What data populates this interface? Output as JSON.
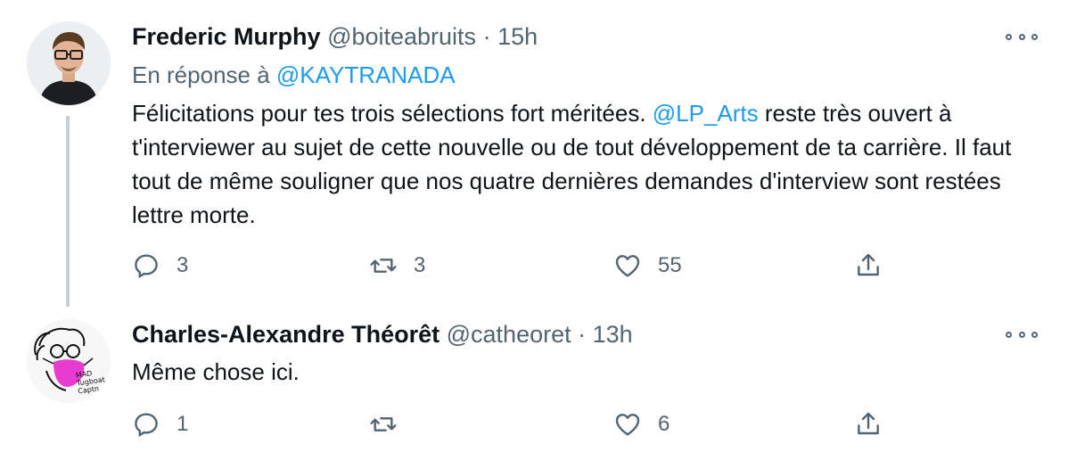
{
  "tweets": [
    {
      "name": "Frederic Murphy",
      "handle": "@boiteabruits",
      "separator": "·",
      "time": "15h",
      "reply_prefix": "En réponse à",
      "reply_to": "@KAYTRANADA",
      "text_part1": "Félicitations pour tes trois sélections fort méritées. ",
      "mention": "@LP_Arts",
      "text_part2": " reste très ouvert à t'interviewer au sujet de cette nouvelle ou de tout développement de ta carrière. Il faut tout de même souligner que nos quatre dernières demandes d'interview sont restées lettre morte.",
      "replies": "3",
      "retweets": "3",
      "likes": "55"
    },
    {
      "name": "Charles-Alexandre Théorêt",
      "handle": "@catheoret",
      "separator": "·",
      "time": "13h",
      "text": "Même chose ici.",
      "replies": "1",
      "retweets": "",
      "likes": "6",
      "avatar_caption": "MAD Tugboat Captn"
    }
  ],
  "colors": {
    "link": "#1d9bf0",
    "muted": "#536471",
    "thread_line": "#c4cfd6",
    "mask": "#e83bd0"
  }
}
